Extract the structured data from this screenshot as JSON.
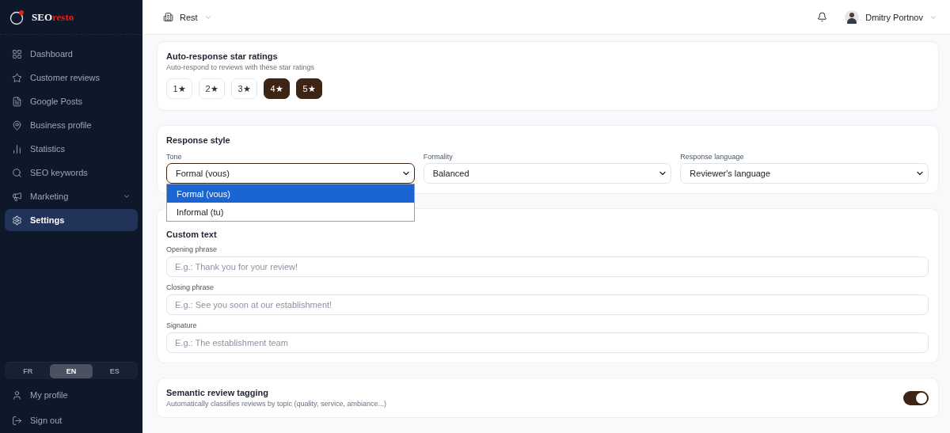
{
  "sidebar": {
    "logo": {
      "part_1": "SEO",
      "part_2": "resto"
    },
    "items": [
      {
        "label": "Dashboard",
        "selected": false,
        "expandable": false
      },
      {
        "label": "Customer reviews",
        "selected": false,
        "expandable": false
      },
      {
        "label": "Google Posts",
        "selected": false,
        "expandable": false
      },
      {
        "label": "Business profile",
        "selected": false,
        "expandable": false
      },
      {
        "label": "Statistics",
        "selected": false,
        "expandable": false
      },
      {
        "label": "SEO keywords",
        "selected": false,
        "expandable": false
      },
      {
        "label": "Marketing",
        "selected": false,
        "expandable": true
      },
      {
        "label": "Settings",
        "selected": true,
        "expandable": false
      }
    ],
    "languages": [
      {
        "label": "FR",
        "selected": false
      },
      {
        "label": "EN",
        "selected": true
      },
      {
        "label": "ES",
        "selected": false
      }
    ],
    "bottom_items": [
      {
        "label": "My profile"
      },
      {
        "label": "Sign out"
      }
    ]
  },
  "header": {
    "establishment": "Rest",
    "user_name": "Dmitry Portnov"
  },
  "star_ratings": {
    "title": "Auto-response star ratings",
    "subtitle": "Auto-respond to reviews with these star ratings",
    "options": [
      {
        "label": "1★",
        "selected": false
      },
      {
        "label": "2★",
        "selected": false
      },
      {
        "label": "3★",
        "selected": false
      },
      {
        "label": "4★",
        "selected": true
      },
      {
        "label": "5★",
        "selected": true
      }
    ]
  },
  "response_style": {
    "title": "Response style",
    "selects": [
      {
        "label": "Tone",
        "value": "Formal (vous)",
        "open": true
      },
      {
        "label": "Formality",
        "value": "Balanced",
        "open": false
      },
      {
        "label": "Response language",
        "value": "Reviewer's language",
        "open": false
      }
    ],
    "tone_options": [
      {
        "label": "Formal (vous)",
        "selected": true
      },
      {
        "label": "Informal (tu)",
        "selected": false
      }
    ]
  },
  "custom_text": {
    "title": "Custom text",
    "fields": [
      {
        "label": "Opening phrase",
        "placeholder": "E.g.: Thank you for your review!"
      },
      {
        "label": "Closing phrase",
        "placeholder": "E.g.: See you soon at our establishment!"
      },
      {
        "label": "Signature",
        "placeholder": "E.g.: The establishment team"
      }
    ]
  },
  "semantic_tagging": {
    "title": "Semantic review tagging",
    "subtitle": "Automatically classifies reviews by topic (quality, service, ambiance...)",
    "on": true
  }
}
